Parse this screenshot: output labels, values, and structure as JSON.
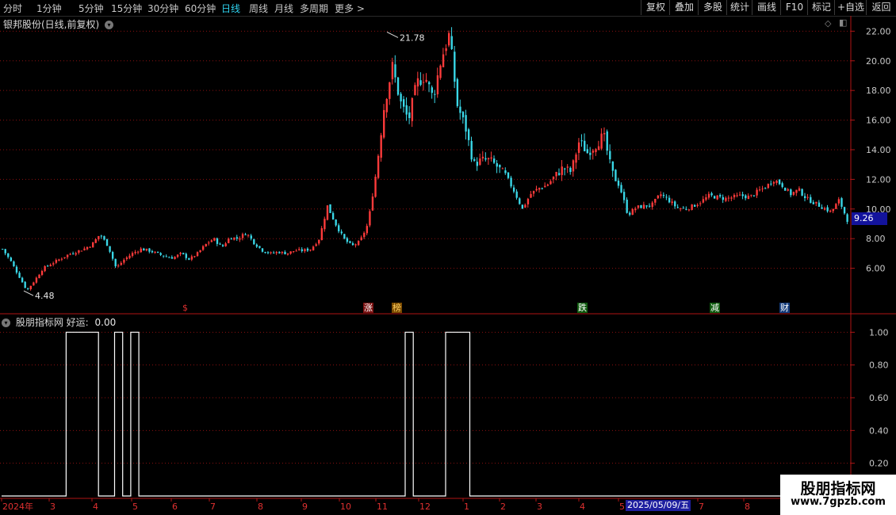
{
  "toolbar": {
    "timeframes": [
      "分时",
      "1分钟",
      "5分钟",
      "15分钟",
      "30分钟",
      "60分钟",
      "日线",
      "周线",
      "月线",
      "多周期",
      "更多 >"
    ],
    "active_timeframe": "日线",
    "buttons": [
      "复权",
      "叠加",
      "多股",
      "统计",
      "画线",
      "F10",
      "标记",
      "+自选",
      "返回"
    ]
  },
  "stock_title": "银邦股份(日线,前复权)",
  "indicator": {
    "name": "股朋指标网",
    "label": "好运:",
    "value": "0.00"
  },
  "price_axis": [
    "22.00",
    "20.00",
    "18.00",
    "16.00",
    "14.00",
    "12.00",
    "10.00",
    "8.00",
    "6.00"
  ],
  "indicator_axis": [
    "1.00",
    "0.80",
    "0.60",
    "0.40",
    "0.20"
  ],
  "annotations": {
    "high": "21.78",
    "low": "4.48",
    "current_price": "9.26"
  },
  "event_badges": [
    {
      "text": "$",
      "color": "#e03030"
    },
    {
      "text": "涨",
      "color": "#e03030"
    },
    {
      "text": "榜",
      "color": "#e0a000"
    },
    {
      "text": "跌",
      "color": "#30b030"
    },
    {
      "text": "减",
      "color": "#30b030"
    },
    {
      "text": "财",
      "color": "#4aa0ff"
    }
  ],
  "time_axis": [
    "2024年",
    "3",
    "4",
    "5",
    "6",
    "7",
    "8",
    "9",
    "10",
    "11",
    "12",
    "1",
    "2",
    "3",
    "4",
    "5",
    "7",
    "8"
  ],
  "selected_date": "2025/05/09/五",
  "watermark": {
    "title": "股朋指标网",
    "url": "www.7gpzb.com"
  },
  "colors": {
    "up": "#ff3b3b",
    "down": "#3ad8e8",
    "grid": "#8b1010",
    "indicator_line": "#ffffff"
  },
  "chart_data": [
    {
      "type": "candlestick",
      "title": "银邦股份(日线,前复权)",
      "ylim": [
        4.0,
        22.5
      ],
      "yticks": [
        6,
        8,
        10,
        12,
        14,
        16,
        18,
        20,
        22
      ],
      "x_months": [
        "2024年",
        "3",
        "4",
        "5",
        "6",
        "7",
        "8",
        "9",
        "10",
        "11",
        "12",
        "1",
        "2",
        "3",
        "4",
        "5",
        "7",
        "8"
      ],
      "close_path": [
        7.3,
        6.5,
        5.5,
        4.5,
        5.2,
        6.0,
        6.3,
        6.6,
        6.9,
        7.1,
        7.3,
        7.6,
        8.3,
        7.5,
        6.0,
        6.6,
        7.0,
        7.3,
        7.2,
        7.0,
        6.8,
        6.7,
        7.0,
        6.6,
        7.0,
        7.6,
        8.0,
        7.4,
        8.1,
        8.0,
        8.4,
        7.7,
        7.2,
        7.0,
        7.1,
        7.0,
        7.2,
        7.2,
        7.3,
        8.0,
        10.2,
        9.0,
        8.0,
        7.5,
        7.8,
        9.0,
        12.5,
        17.0,
        19.6,
        17.2,
        16.0,
        18.5,
        19.0,
        17.5,
        20.1,
        21.78,
        17.0,
        15.5,
        13.0,
        13.3,
        13.3,
        12.8,
        12.2,
        11.2,
        10.0,
        11.0,
        11.4,
        11.6,
        12.2,
        12.8,
        12.5,
        14.6,
        13.8,
        14.3,
        15.0,
        12.5,
        11.5,
        9.6,
        10.1,
        10.2,
        10.3,
        11.0,
        10.6,
        10.1,
        10.0,
        10.2,
        10.5,
        10.9,
        10.8,
        10.7,
        10.8,
        10.9,
        10.8,
        11.2,
        11.5,
        12.0,
        11.6,
        11.0,
        11.3,
        10.7,
        10.4,
        10.1,
        9.8,
        10.6,
        9.26
      ],
      "high": 21.78,
      "low": 4.48,
      "last": 9.26
    },
    {
      "type": "line",
      "name": "好运",
      "ylim": [
        0,
        1.05
      ],
      "yticks": [
        0.2,
        0.4,
        0.6,
        0.8,
        1.0
      ],
      "step_signal": [
        0,
        0,
        0,
        0,
        0,
        0,
        0,
        0,
        1,
        1,
        1,
        1,
        0,
        0,
        1,
        0,
        1,
        0,
        0,
        0,
        0,
        0,
        0,
        0,
        0,
        0,
        0,
        0,
        0,
        0,
        0,
        0,
        0,
        0,
        0,
        0,
        0,
        0,
        0,
        0,
        0,
        0,
        0,
        0,
        0,
        0,
        0,
        0,
        0,
        0,
        1,
        0,
        0,
        0,
        0,
        1,
        1,
        1,
        0,
        0,
        0,
        0,
        0,
        0,
        0,
        0,
        0,
        0,
        0,
        0,
        0,
        0,
        0,
        0,
        0,
        0,
        0,
        0,
        0,
        0,
        0,
        0,
        0,
        0,
        0,
        0,
        0,
        0,
        0,
        0,
        0,
        0,
        0,
        0,
        0,
        0,
        0,
        0,
        0,
        0,
        0,
        0,
        0,
        0,
        0
      ],
      "current_value": 0.0
    }
  ]
}
